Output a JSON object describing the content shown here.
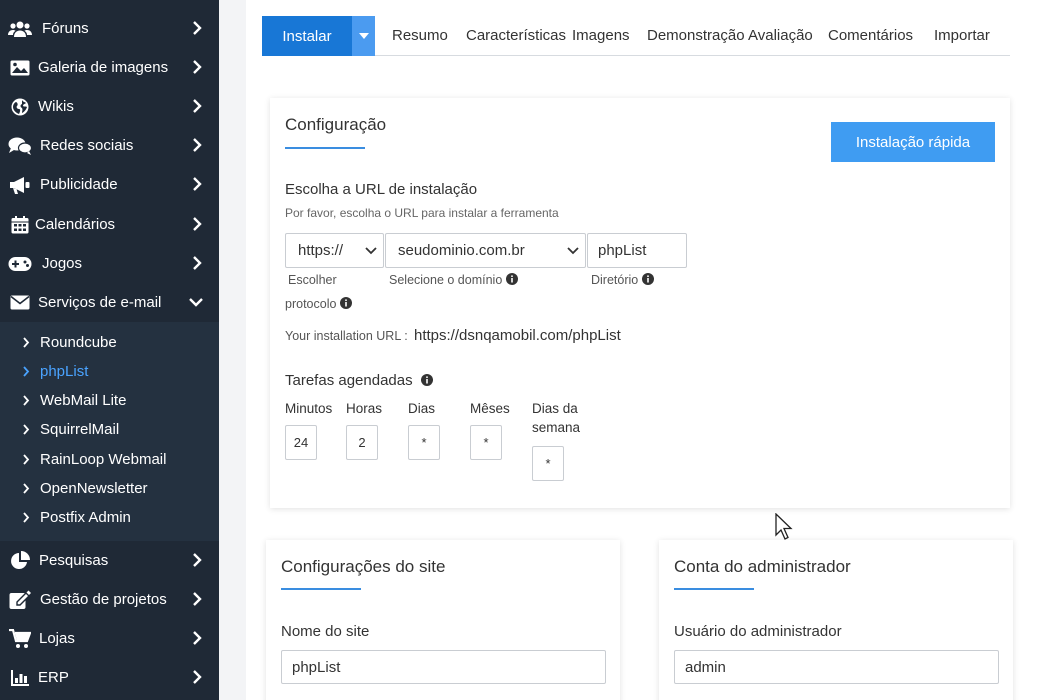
{
  "sidebar": {
    "items": [
      {
        "label": "Fóruns",
        "icon": "users-icon"
      },
      {
        "label": "Galeria de imagens",
        "icon": "image-icon"
      },
      {
        "label": "Wikis",
        "icon": "globe-icon"
      },
      {
        "label": "Redes sociais",
        "icon": "comments-icon"
      },
      {
        "label": "Publicidade",
        "icon": "megaphone-icon"
      },
      {
        "label": "Calendários",
        "icon": "calendar-icon"
      },
      {
        "label": "Jogos",
        "icon": "gamepad-icon"
      },
      {
        "label": "Serviços de e-mail",
        "icon": "envelope-icon"
      }
    ],
    "sub_items": [
      {
        "label": "Roundcube"
      },
      {
        "label": "phpList",
        "active": true
      },
      {
        "label": "WebMail Lite"
      },
      {
        "label": "SquirrelMail"
      },
      {
        "label": "RainLoop Webmail"
      },
      {
        "label": "OpenNewsletter"
      },
      {
        "label": "Postfix Admin"
      }
    ],
    "items_after": [
      {
        "label": "Pesquisas",
        "icon": "pie-chart-icon"
      },
      {
        "label": "Gestão de projetos",
        "icon": "edit-icon"
      },
      {
        "label": "Lojas",
        "icon": "cart-icon"
      },
      {
        "label": "ERP",
        "icon": "bar-chart-icon"
      }
    ]
  },
  "tabs": {
    "install_label": "Instalar",
    "items": [
      "Resumo",
      "Características",
      "Imagens",
      "Demonstração",
      "Avaliação",
      "Comentários",
      "Importar"
    ]
  },
  "config": {
    "title": "Configuração",
    "quick_install": "Instalação rápida",
    "url_label": "Escolha a URL de instalação",
    "url_hint": "Por favor, escolha o URL para instalar a ferramenta",
    "protocol_value": "https://",
    "domain_value": "seudominio.com.br",
    "directory_value": "phpList",
    "protocol_caption_1": "Escolher",
    "protocol_caption_2": "protocolo",
    "domain_caption": "Selecione o domínio",
    "directory_caption": "Diretório",
    "install_url_label": "Your installation URL :",
    "install_url_value": "https://dsnqamobil.com/phpList",
    "cron_label": "Tarefas agendadas",
    "cron": {
      "minutes_label": "Minutos",
      "minutes_value": "24",
      "hours_label": "Horas",
      "hours_value": "2",
      "days_label": "Dias",
      "days_value": "*",
      "months_label": "Mêses",
      "months_value": "*",
      "weekday_label_1": "Dias da",
      "weekday_label_2": "semana",
      "weekday_value": "*"
    }
  },
  "site": {
    "title": "Configurações do site",
    "name_label": "Nome do site",
    "name_value": "phpList"
  },
  "admin": {
    "title": "Conta do administrador",
    "user_label": "Usuário do administrador",
    "user_value": "admin"
  },
  "colors": {
    "sidebar_bg": "#1f2936",
    "accent": "#1877d6",
    "active_link": "#4aa3ff"
  }
}
